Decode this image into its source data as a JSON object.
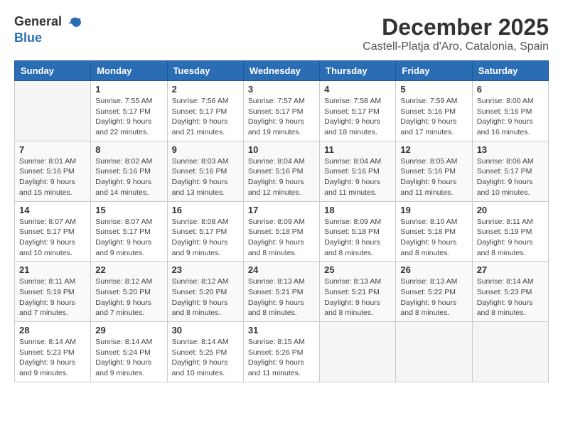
{
  "header": {
    "logo_general": "General",
    "logo_blue": "Blue",
    "title": "December 2025",
    "subtitle": "Castell-Platja d'Aro, Catalonia, Spain"
  },
  "calendar": {
    "weekdays": [
      "Sunday",
      "Monday",
      "Tuesday",
      "Wednesday",
      "Thursday",
      "Friday",
      "Saturday"
    ],
    "weeks": [
      [
        {
          "day": "",
          "sunrise": "",
          "sunset": "",
          "daylight": ""
        },
        {
          "day": "1",
          "sunrise": "Sunrise: 7:55 AM",
          "sunset": "Sunset: 5:17 PM",
          "daylight": "Daylight: 9 hours and 22 minutes."
        },
        {
          "day": "2",
          "sunrise": "Sunrise: 7:56 AM",
          "sunset": "Sunset: 5:17 PM",
          "daylight": "Daylight: 9 hours and 21 minutes."
        },
        {
          "day": "3",
          "sunrise": "Sunrise: 7:57 AM",
          "sunset": "Sunset: 5:17 PM",
          "daylight": "Daylight: 9 hours and 19 minutes."
        },
        {
          "day": "4",
          "sunrise": "Sunrise: 7:58 AM",
          "sunset": "Sunset: 5:17 PM",
          "daylight": "Daylight: 9 hours and 18 minutes."
        },
        {
          "day": "5",
          "sunrise": "Sunrise: 7:59 AM",
          "sunset": "Sunset: 5:16 PM",
          "daylight": "Daylight: 9 hours and 17 minutes."
        },
        {
          "day": "6",
          "sunrise": "Sunrise: 8:00 AM",
          "sunset": "Sunset: 5:16 PM",
          "daylight": "Daylight: 9 hours and 16 minutes."
        }
      ],
      [
        {
          "day": "7",
          "sunrise": "Sunrise: 8:01 AM",
          "sunset": "Sunset: 5:16 PM",
          "daylight": "Daylight: 9 hours and 15 minutes."
        },
        {
          "day": "8",
          "sunrise": "Sunrise: 8:02 AM",
          "sunset": "Sunset: 5:16 PM",
          "daylight": "Daylight: 9 hours and 14 minutes."
        },
        {
          "day": "9",
          "sunrise": "Sunrise: 8:03 AM",
          "sunset": "Sunset: 5:16 PM",
          "daylight": "Daylight: 9 hours and 13 minutes."
        },
        {
          "day": "10",
          "sunrise": "Sunrise: 8:04 AM",
          "sunset": "Sunset: 5:16 PM",
          "daylight": "Daylight: 9 hours and 12 minutes."
        },
        {
          "day": "11",
          "sunrise": "Sunrise: 8:04 AM",
          "sunset": "Sunset: 5:16 PM",
          "daylight": "Daylight: 9 hours and 11 minutes."
        },
        {
          "day": "12",
          "sunrise": "Sunrise: 8:05 AM",
          "sunset": "Sunset: 5:16 PM",
          "daylight": "Daylight: 9 hours and 11 minutes."
        },
        {
          "day": "13",
          "sunrise": "Sunrise: 8:06 AM",
          "sunset": "Sunset: 5:17 PM",
          "daylight": "Daylight: 9 hours and 10 minutes."
        }
      ],
      [
        {
          "day": "14",
          "sunrise": "Sunrise: 8:07 AM",
          "sunset": "Sunset: 5:17 PM",
          "daylight": "Daylight: 9 hours and 10 minutes."
        },
        {
          "day": "15",
          "sunrise": "Sunrise: 8:07 AM",
          "sunset": "Sunset: 5:17 PM",
          "daylight": "Daylight: 9 hours and 9 minutes."
        },
        {
          "day": "16",
          "sunrise": "Sunrise: 8:08 AM",
          "sunset": "Sunset: 5:17 PM",
          "daylight": "Daylight: 9 hours and 9 minutes."
        },
        {
          "day": "17",
          "sunrise": "Sunrise: 8:09 AM",
          "sunset": "Sunset: 5:18 PM",
          "daylight": "Daylight: 9 hours and 8 minutes."
        },
        {
          "day": "18",
          "sunrise": "Sunrise: 8:09 AM",
          "sunset": "Sunset: 5:18 PM",
          "daylight": "Daylight: 9 hours and 8 minutes."
        },
        {
          "day": "19",
          "sunrise": "Sunrise: 8:10 AM",
          "sunset": "Sunset: 5:18 PM",
          "daylight": "Daylight: 9 hours and 8 minutes."
        },
        {
          "day": "20",
          "sunrise": "Sunrise: 8:11 AM",
          "sunset": "Sunset: 5:19 PM",
          "daylight": "Daylight: 9 hours and 8 minutes."
        }
      ],
      [
        {
          "day": "21",
          "sunrise": "Sunrise: 8:11 AM",
          "sunset": "Sunset: 5:19 PM",
          "daylight": "Daylight: 9 hours and 7 minutes."
        },
        {
          "day": "22",
          "sunrise": "Sunrise: 8:12 AM",
          "sunset": "Sunset: 5:20 PM",
          "daylight": "Daylight: 9 hours and 7 minutes."
        },
        {
          "day": "23",
          "sunrise": "Sunrise: 8:12 AM",
          "sunset": "Sunset: 5:20 PM",
          "daylight": "Daylight: 9 hours and 8 minutes."
        },
        {
          "day": "24",
          "sunrise": "Sunrise: 8:13 AM",
          "sunset": "Sunset: 5:21 PM",
          "daylight": "Daylight: 9 hours and 8 minutes."
        },
        {
          "day": "25",
          "sunrise": "Sunrise: 8:13 AM",
          "sunset": "Sunset: 5:21 PM",
          "daylight": "Daylight: 9 hours and 8 minutes."
        },
        {
          "day": "26",
          "sunrise": "Sunrise: 8:13 AM",
          "sunset": "Sunset: 5:22 PM",
          "daylight": "Daylight: 9 hours and 8 minutes."
        },
        {
          "day": "27",
          "sunrise": "Sunrise: 8:14 AM",
          "sunset": "Sunset: 5:23 PM",
          "daylight": "Daylight: 9 hours and 8 minutes."
        }
      ],
      [
        {
          "day": "28",
          "sunrise": "Sunrise: 8:14 AM",
          "sunset": "Sunset: 5:23 PM",
          "daylight": "Daylight: 9 hours and 9 minutes."
        },
        {
          "day": "29",
          "sunrise": "Sunrise: 8:14 AM",
          "sunset": "Sunset: 5:24 PM",
          "daylight": "Daylight: 9 hours and 9 minutes."
        },
        {
          "day": "30",
          "sunrise": "Sunrise: 8:14 AM",
          "sunset": "Sunset: 5:25 PM",
          "daylight": "Daylight: 9 hours and 10 minutes."
        },
        {
          "day": "31",
          "sunrise": "Sunrise: 8:15 AM",
          "sunset": "Sunset: 5:26 PM",
          "daylight": "Daylight: 9 hours and 11 minutes."
        },
        {
          "day": "",
          "sunrise": "",
          "sunset": "",
          "daylight": ""
        },
        {
          "day": "",
          "sunrise": "",
          "sunset": "",
          "daylight": ""
        },
        {
          "day": "",
          "sunrise": "",
          "sunset": "",
          "daylight": ""
        }
      ]
    ]
  }
}
